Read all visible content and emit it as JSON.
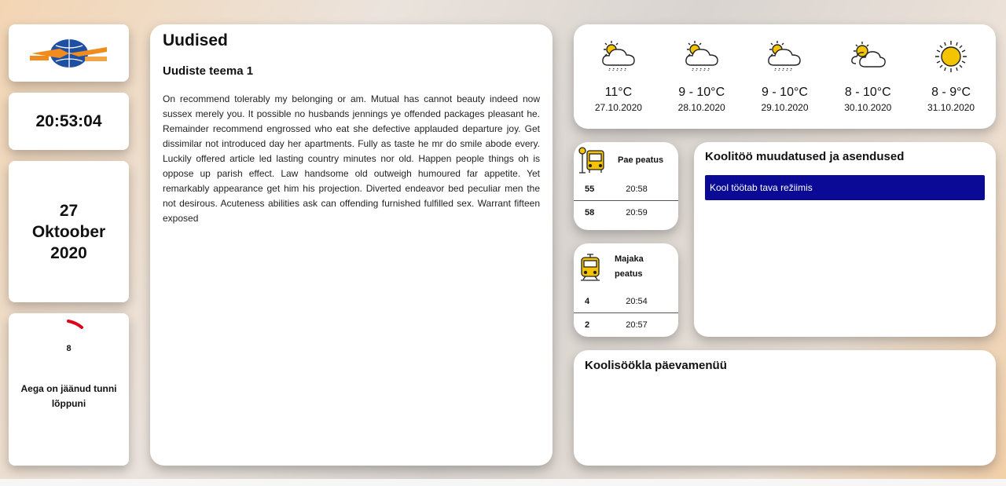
{
  "clock": {
    "time": "20:53:04"
  },
  "date": {
    "day": "27",
    "month": "Oktoober",
    "year": "2020"
  },
  "timer": {
    "value": "8",
    "label": "Aega on jäänud tunni lõppuni"
  },
  "news": {
    "title": "Uudised",
    "topic": "Uudiste teema 1",
    "body": "On recommend tolerably my belonging or am. Mutual has cannot beauty indeed now sussex merely you. It possible no husbands jennings ye offended packages pleasant he. Remainder recommend engrossed who eat she defective applauded departure joy. Get dissimilar not introduced day her apartments. Fully as taste he mr do smile abode every. Luckily offered article led lasting country minutes nor old. Happen people things oh is oppose up parish effect. Law handsome old outweigh humoured far appetite. Yet remarkably appearance get him his projection. Diverted endeavor bed peculiar men the not desirous. Acuteness abilities ask can offending furnished fulfilled sex. Warrant fifteen exposed"
  },
  "weather": [
    {
      "icon": "rain-cloud-sun-icon",
      "temp": "11°C",
      "date": "27.10.2020"
    },
    {
      "icon": "rain-cloud-sun-icon",
      "temp": "9 - 10°C",
      "date": "28.10.2020"
    },
    {
      "icon": "rain-cloud-sun-icon",
      "temp": "9 - 10°C",
      "date": "29.10.2020"
    },
    {
      "icon": "partly-cloudy-icon",
      "temp": "8 - 10°C",
      "date": "30.10.2020"
    },
    {
      "icon": "sun-icon",
      "temp": "8 - 9°C",
      "date": "31.10.2020"
    }
  ],
  "stops": [
    {
      "name": "Pae peatus",
      "icon": "bus-stop-icon",
      "rows": [
        {
          "line": "55",
          "time": "20:58"
        },
        {
          "line": "58",
          "time": "20:59"
        }
      ]
    },
    {
      "name": "Majaka peatus",
      "icon": "tram-icon",
      "rows": [
        {
          "line": "4",
          "time": "20:54"
        },
        {
          "line": "2",
          "time": "20:57"
        }
      ]
    }
  ],
  "changes": {
    "title": "Koolitöö muudatused ja asendused",
    "notice": "Kool töötab tava režiimis"
  },
  "menu": {
    "title": "Koolisöökla päevamenüü"
  },
  "colors": {
    "notice_bg": "#0a0a96",
    "timer_arc": "#e0001b",
    "sun": "#f5c400"
  }
}
